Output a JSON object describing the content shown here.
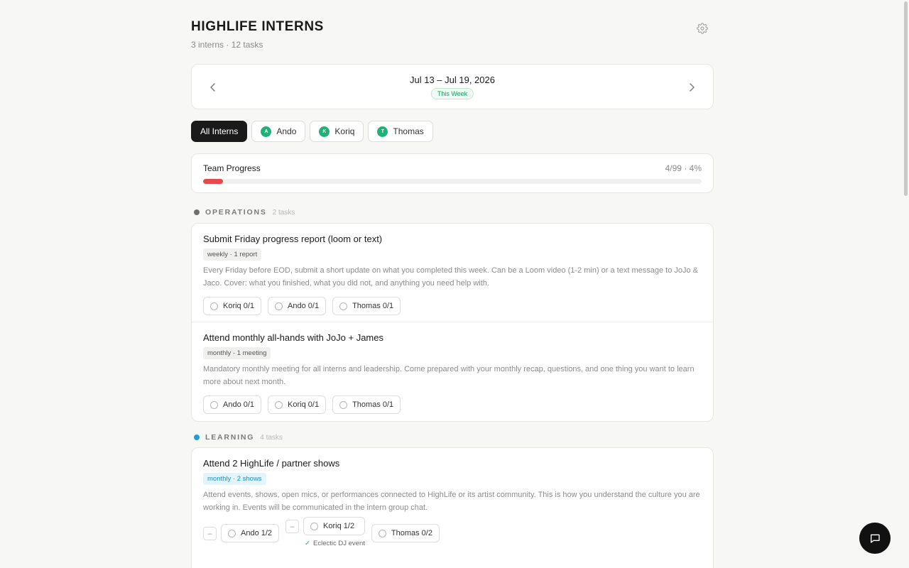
{
  "header": {
    "title": "HIGHLIFE INTERNS",
    "subtitle": "3 interns · 12 tasks",
    "settings_icon": "gear-icon"
  },
  "week": {
    "label": "Jul 13 – Jul 19, 2026",
    "badge": "This Week",
    "prev_icon": "chevron-left-icon",
    "next_icon": "chevron-right-icon"
  },
  "filters": [
    {
      "label": "All Interns",
      "active": true
    },
    {
      "label": "Ando",
      "initial": "A"
    },
    {
      "label": "Koriq",
      "initial": "K"
    },
    {
      "label": "Thomas",
      "initial": "T"
    }
  ],
  "progress": {
    "title": "Team Progress",
    "count": "4/99 · 4%",
    "fraction": 0.04,
    "color": "#e5484d"
  },
  "sections": [
    {
      "name": "OPERATIONS",
      "count": "2 tasks",
      "dot_color": "#6e6e6e",
      "tasks": [
        {
          "title": "Submit Friday progress report (loom or text)",
          "tag": "weekly · 1 report",
          "description": "Every Friday before EOD, submit a short update on what you completed this week. Can be a Loom video (1-2 min) or a text message to JoJo & Jaco. Cover: what you finished, what you did not, and anything you need help with.",
          "assignees": [
            "Koriq 0/1",
            "Ando 0/1",
            "Thomas 0/1"
          ]
        },
        {
          "title": "Attend monthly all-hands with JoJo + James",
          "tag": "monthly · 1 meeting",
          "description": "Mandatory monthly meeting for all interns and leadership. Come prepared with your monthly recap, questions, and one thing you want to learn more about next month.",
          "assignees": [
            "Ando 0/1",
            "Koriq 0/1",
            "Thomas 0/1"
          ]
        }
      ]
    },
    {
      "name": "LEARNING",
      "count": "4 tasks",
      "dot_color": "#1a9fd9",
      "tasks": [
        {
          "title": "Attend 2 HighLife / partner shows",
          "tag": "monthly · 2 shows",
          "description": "Attend events, shows, open mics, or performances connected to HighLife or its artist community. This is how you understand the culture you are working in. Events will be communicated in the intern group chat.",
          "assignees": [
            "Ando 1/2",
            "Koriq 1/2",
            "Thomas 0/2"
          ],
          "minus": "–",
          "note": "Eclectic DJ event",
          "note_icon": "check-icon"
        }
      ]
    }
  ],
  "chat_icon": "chat-bubble-icon"
}
